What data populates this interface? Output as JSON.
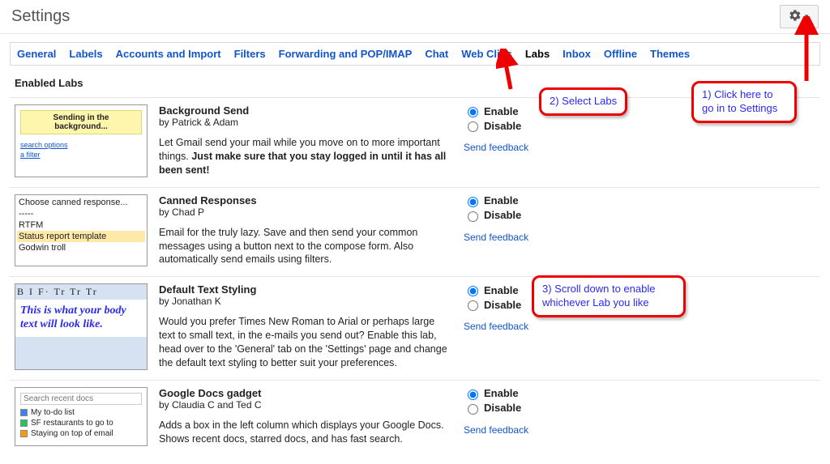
{
  "page_title": "Settings",
  "tabs": {
    "general": "General",
    "labels": "Labels",
    "accounts": "Accounts and Import",
    "filters": "Filters",
    "forwarding": "Forwarding and POP/IMAP",
    "chat": "Chat",
    "webclips": "Web Clips",
    "labs": "Labs",
    "inbox": "Inbox",
    "offline": "Offline",
    "themes": "Themes"
  },
  "section_title": "Enabled Labs",
  "enable_label": "Enable",
  "disable_label": "Disable",
  "feedback_label": "Send feedback",
  "labs": [
    {
      "title": "Background Send",
      "author": "by Patrick & Adam",
      "desc_pre": "Let Gmail send your mail while you move on to more important things. ",
      "desc_bold": "Just make sure that you stay logged in until it has all been sent!",
      "thumb": {
        "band": "Sending in the background...",
        "link1": "search options",
        "link2": "a filter"
      }
    },
    {
      "title": "Canned Responses",
      "author": "by Chad P",
      "desc": "Email for the truly lazy. Save and then send your common messages using a button next to the compose form. Also automatically send emails using filters.",
      "thumb": {
        "opt0": "Choose canned response...",
        "opt1": "-----",
        "opt2": "RTFM",
        "opt3": "Status report template",
        "opt4": "Godwin troll"
      }
    },
    {
      "title": "Default Text Styling",
      "author": "by Jonathan K",
      "desc": "Would you prefer Times New Roman to Arial or perhaps large text to small text, in the e-mails you send out? Enable this lab, head over to the 'General' tab on the 'Settings' page and change the default text styling to better suit your preferences.",
      "thumb": {
        "toolbar": "B I F· Tr Tr Tr",
        "body": "This is what your body text will look like."
      }
    },
    {
      "title": "Google Docs gadget",
      "author": "by Claudia C and Ted C",
      "desc": "Adds a box in the left column which displays your Google Docs. Shows recent docs, starred docs, and has fast search.",
      "thumb": {
        "placeholder": "Search recent docs",
        "d1": "My to-do list",
        "d2": "SF restaurants to go to",
        "d3": "Staying on top of email"
      }
    }
  ],
  "callouts": {
    "c1": "1) Click here to go in to Settings",
    "c2": "2) Select Labs",
    "c3a": "3) Scroll down to enable",
    "c3b": "whichever Lab you like"
  }
}
